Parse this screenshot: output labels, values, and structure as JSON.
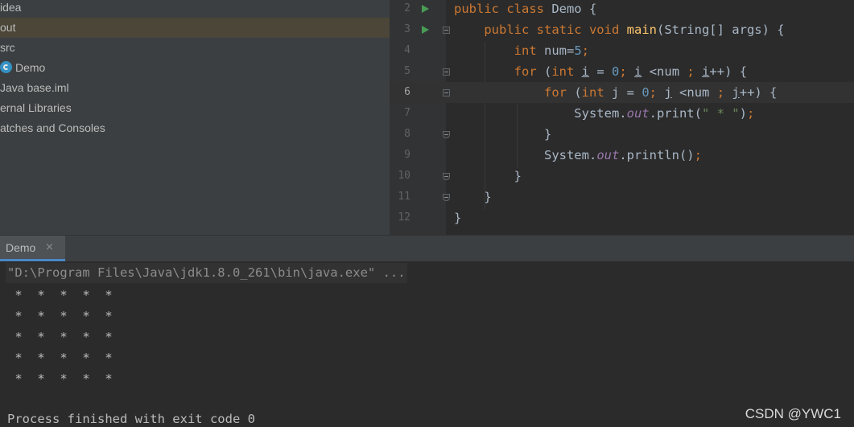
{
  "project_tree": [
    {
      "label": "idea",
      "selected": false
    },
    {
      "label": "out",
      "selected": true
    },
    {
      "label": "src",
      "selected": false
    },
    {
      "label": "Demo",
      "selected": false
    },
    {
      "label": "Java base.iml",
      "selected": false
    },
    {
      "label": "ernal Libraries",
      "selected": false
    },
    {
      "label": "atches and Consoles",
      "selected": false
    }
  ],
  "editor": {
    "line_numbers": [
      "2",
      "3",
      "4",
      "5",
      "6",
      "7",
      "8",
      "9",
      "10",
      "11",
      "12"
    ],
    "current_line": "6"
  },
  "run_window": {
    "tab_label": "Demo",
    "tab_close": "×",
    "command": "\"D:\\Program Files\\Java\\jdk1.8.0_261\\bin\\java.exe\" ...",
    "output": [
      " *  *  *  *  *",
      " *  *  *  *  *",
      " *  *  *  *  *",
      " *  *  *  *  *",
      " *  *  *  *  *"
    ],
    "finish_message": "Process finished with exit code 0"
  },
  "watermark": "CSDN @YWC1",
  "colors": {
    "keyword": "#cc7832",
    "method": "#ffc66d",
    "number": "#6897bb",
    "string": "#6a8759",
    "field": "#9876aa",
    "tab_accent": "#4a88c7",
    "run_icon": "#499c54"
  }
}
